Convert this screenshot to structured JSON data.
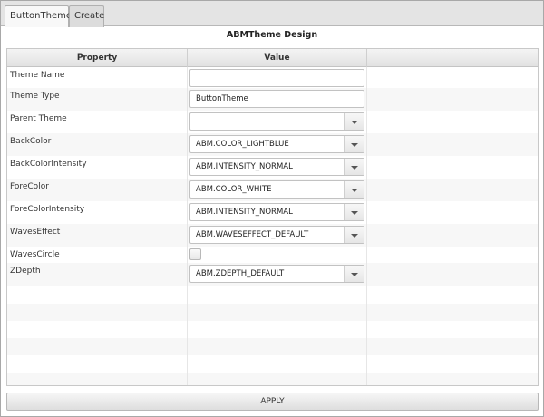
{
  "tabs": [
    {
      "label": "ButtonTheme",
      "active": true
    },
    {
      "label": "Create",
      "active": false
    }
  ],
  "title": "ABMTheme Design",
  "grid": {
    "headers": [
      "Property",
      "Value"
    ],
    "rows": [
      {
        "label": "Theme Name",
        "kind": "text",
        "value": ""
      },
      {
        "label": "Theme Type",
        "kind": "text",
        "value": "ButtonTheme"
      },
      {
        "label": "Parent Theme",
        "kind": "select",
        "value": ""
      },
      {
        "label": "BackColor",
        "kind": "select",
        "value": "ABM.COLOR_LIGHTBLUE"
      },
      {
        "label": "BackColorIntensity",
        "kind": "select",
        "value": "ABM.INTENSITY_NORMAL"
      },
      {
        "label": "ForeColor",
        "kind": "select",
        "value": "ABM.COLOR_WHITE"
      },
      {
        "label": "ForeColorIntensity",
        "kind": "select",
        "value": "ABM.INTENSITY_NORMAL"
      },
      {
        "label": "WavesEffect",
        "kind": "select",
        "value": "ABM.WAVESEFFECT_DEFAULT"
      },
      {
        "label": "WavesCircle",
        "kind": "checkbox",
        "value": false
      },
      {
        "label": "ZDepth",
        "kind": "select",
        "value": "ABM.ZDEPTH_DEFAULT"
      }
    ]
  },
  "apply_label": "APPLY"
}
